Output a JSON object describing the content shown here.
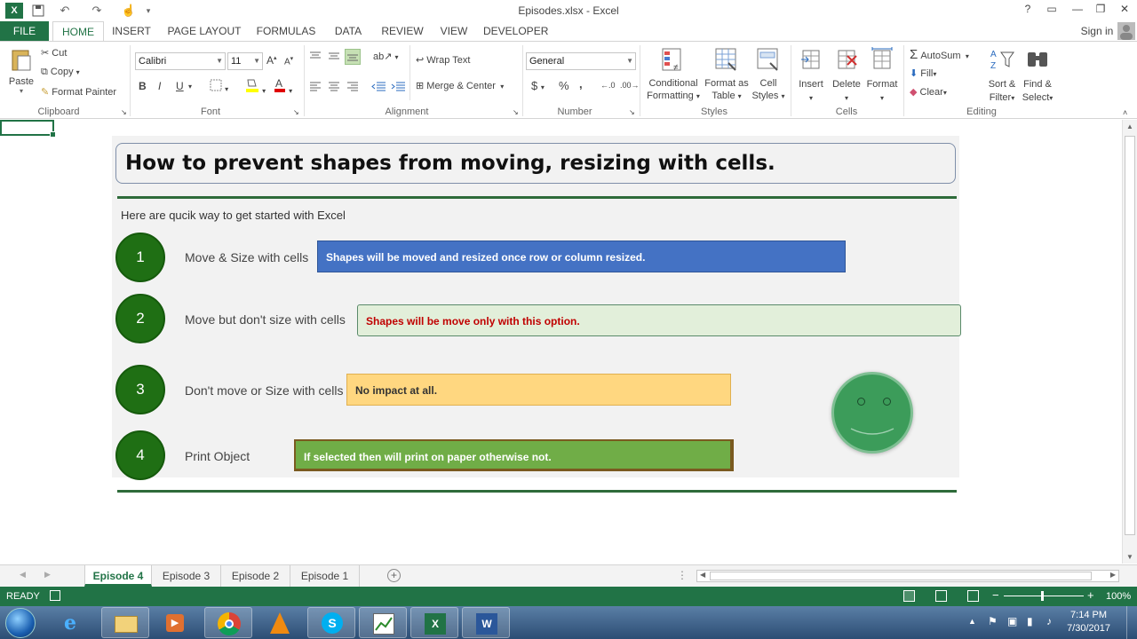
{
  "window": {
    "title": "Episodes.xlsx - Excel",
    "help": "?",
    "sign_in": "Sign in"
  },
  "tabs": [
    "FILE",
    "HOME",
    "INSERT",
    "PAGE LAYOUT",
    "FORMULAS",
    "DATA",
    "REVIEW",
    "VIEW",
    "DEVELOPER"
  ],
  "ribbon": {
    "clipboard": {
      "paste": "Paste",
      "cut": "Cut",
      "copy": "Copy",
      "format_painter": "Format Painter",
      "label": "Clipboard"
    },
    "font": {
      "name": "Calibri",
      "size": "11",
      "bold": "B",
      "italic": "I",
      "underline": "U",
      "label": "Font"
    },
    "alignment": {
      "wrap_text": "Wrap Text",
      "merge_center": "Merge & Center",
      "label": "Alignment"
    },
    "number": {
      "format": "General",
      "currency": "$",
      "percent": "%",
      "comma": ",",
      "label": "Number"
    },
    "styles": {
      "conditional": [
        "Conditional",
        "Formatting"
      ],
      "format_table": [
        "Format as",
        "Table"
      ],
      "cell_styles": [
        "Cell",
        "Styles"
      ],
      "label": "Styles"
    },
    "cells": {
      "insert": "Insert",
      "delete": "Delete",
      "format": "Format",
      "label": "Cells"
    },
    "editing": {
      "autosum": "AutoSum",
      "fill": "Fill",
      "clear": "Clear",
      "sort_filter": [
        "Sort &",
        "Filter"
      ],
      "find_select": [
        "Find &",
        "Select"
      ],
      "label": "Editing"
    }
  },
  "sheet": {
    "heading": "How to prevent shapes from moving, resizing with cells.",
    "intro": "Here are qucik way to get started with Excel",
    "options": [
      {
        "num": "1",
        "label": "Move & Size with cells",
        "box": "Shapes will be moved and resized once row or column resized.",
        "box_bg": "#4472c4",
        "box_fg": "#ffffff"
      },
      {
        "num": "2",
        "label": "Move but don't size with cells",
        "box": "Shapes will be move only with this option.",
        "box_bg": "#e2efda",
        "box_fg": "#c00000"
      },
      {
        "num": "3",
        "label": "Don't move or Size with cells",
        "box": "No impact at all.",
        "box_bg": "#ffd780",
        "box_fg": "#333333"
      },
      {
        "num": "4",
        "label": "Print Object",
        "box": "If selected then will print on paper otherwise not.",
        "box_bg": "#70ad47",
        "box_fg": "#ffffff"
      }
    ]
  },
  "sheet_tabs": [
    "Episode 4",
    "Episode 3",
    "Episode 2",
    "Episode 1"
  ],
  "status": {
    "mode": "READY",
    "zoom": "100%"
  },
  "clock": {
    "time": "7:14 PM",
    "date": "7/30/2017"
  }
}
